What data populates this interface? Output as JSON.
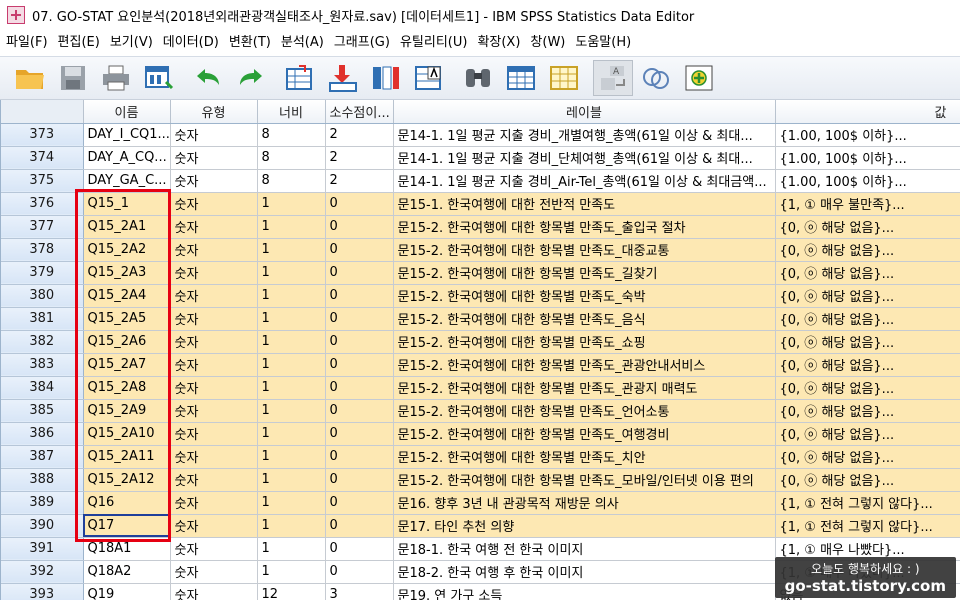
{
  "window": {
    "title": "07. GO-STAT 요인분석(2018년외래관광객실태조사_원자료.sav) [데이터세트1] - IBM SPSS Statistics Data Editor"
  },
  "menu": [
    {
      "label": "파일(F)"
    },
    {
      "label": "편집(E)"
    },
    {
      "label": "보기(V)"
    },
    {
      "label": "데이터(D)"
    },
    {
      "label": "변환(T)"
    },
    {
      "label": "분석(A)"
    },
    {
      "label": "그래프(G)"
    },
    {
      "label": "유틸리티(U)"
    },
    {
      "label": "확장(X)"
    },
    {
      "label": "창(W)"
    },
    {
      "label": "도움말(H)"
    }
  ],
  "toolbar": {
    "icons": [
      "open-folder-icon",
      "save-icon",
      "print-icon",
      "dialog-recall-icon",
      "undo-icon",
      "redo-icon",
      "goto-case-icon",
      "goto-variable-icon",
      "variables-icon",
      "run-descriptives-icon",
      "find-icon",
      "insert-cases-icon",
      "insert-variable-icon",
      "split-file-icon",
      "value-labels-icon",
      "use-sets-icon"
    ]
  },
  "columns": [
    {
      "label": ""
    },
    {
      "label": "이름"
    },
    {
      "label": "유형"
    },
    {
      "label": "너비"
    },
    {
      "label": "소수점이..."
    },
    {
      "label": "레이블"
    },
    {
      "label": "값"
    }
  ],
  "rows": [
    {
      "num": "373",
      "name": "DAY_I_CQ1...",
      "type": "숫자",
      "width": "8",
      "decimals": "2",
      "label": "문14-1. 1일 평균 지출 경비_개별여행_총액(61일 이상 & 최대...",
      "values": "{1.00, 100$ 이하}...",
      "hl": false
    },
    {
      "num": "374",
      "name": "DAY_A_CQ...",
      "type": "숫자",
      "width": "8",
      "decimals": "2",
      "label": "문14-1. 1일 평균 지출 경비_단체여행_총액(61일 이상 & 최대...",
      "values": "{1.00, 100$ 이하}...",
      "hl": false
    },
    {
      "num": "375",
      "name": "DAY_GA_C...",
      "type": "숫자",
      "width": "8",
      "decimals": "2",
      "label": "문14-1. 1일 평균 지출 경비_Air-Tel_총액(61일 이상 & 최대금액...",
      "values": "{1.00, 100$ 이하}...",
      "hl": false
    },
    {
      "num": "376",
      "name": "Q15_1",
      "type": "숫자",
      "width": "1",
      "decimals": "0",
      "label": "문15-1. 한국여행에 대한 전반적 만족도",
      "values": "{1, ① 매우 불만족}...",
      "hl": true
    },
    {
      "num": "377",
      "name": "Q15_2A1",
      "type": "숫자",
      "width": "1",
      "decimals": "0",
      "label": "문15-2. 한국여행에 대한 항목별 만족도_출입국 절차",
      "values": "{0, ⓞ 해당 없음}...",
      "hl": true
    },
    {
      "num": "378",
      "name": "Q15_2A2",
      "type": "숫자",
      "width": "1",
      "decimals": "0",
      "label": "문15-2. 한국여행에 대한 항목별 만족도_대중교통",
      "values": "{0, ⓞ 해당 없음}...",
      "hl": true
    },
    {
      "num": "379",
      "name": "Q15_2A3",
      "type": "숫자",
      "width": "1",
      "decimals": "0",
      "label": "문15-2. 한국여행에 대한 항목별 만족도_길찾기",
      "values": "{0, ⓞ 해당 없음}...",
      "hl": true
    },
    {
      "num": "380",
      "name": "Q15_2A4",
      "type": "숫자",
      "width": "1",
      "decimals": "0",
      "label": "문15-2. 한국여행에 대한 항목별 만족도_숙박",
      "values": "{0, ⓞ 해당 없음}...",
      "hl": true
    },
    {
      "num": "381",
      "name": "Q15_2A5",
      "type": "숫자",
      "width": "1",
      "decimals": "0",
      "label": "문15-2. 한국여행에 대한 항목별 만족도_음식",
      "values": "{0, ⓞ 해당 없음}...",
      "hl": true
    },
    {
      "num": "382",
      "name": "Q15_2A6",
      "type": "숫자",
      "width": "1",
      "decimals": "0",
      "label": "문15-2. 한국여행에 대한 항목별 만족도_쇼핑",
      "values": "{0, ⓞ 해당 없음}...",
      "hl": true
    },
    {
      "num": "383",
      "name": "Q15_2A7",
      "type": "숫자",
      "width": "1",
      "decimals": "0",
      "label": "문15-2. 한국여행에 대한 항목별 만족도_관광안내서비스",
      "values": "{0, ⓞ 해당 없음}...",
      "hl": true
    },
    {
      "num": "384",
      "name": "Q15_2A8",
      "type": "숫자",
      "width": "1",
      "decimals": "0",
      "label": "문15-2. 한국여행에 대한 항목별 만족도_관광지 매력도",
      "values": "{0, ⓞ 해당 없음}...",
      "hl": true
    },
    {
      "num": "385",
      "name": "Q15_2A9",
      "type": "숫자",
      "width": "1",
      "decimals": "0",
      "label": "문15-2. 한국여행에 대한 항목별 만족도_언어소통",
      "values": "{0, ⓞ 해당 없음}...",
      "hl": true
    },
    {
      "num": "386",
      "name": "Q15_2A10",
      "type": "숫자",
      "width": "1",
      "decimals": "0",
      "label": "문15-2. 한국여행에 대한 항목별 만족도_여행경비",
      "values": "{0, ⓞ 해당 없음}...",
      "hl": true
    },
    {
      "num": "387",
      "name": "Q15_2A11",
      "type": "숫자",
      "width": "1",
      "decimals": "0",
      "label": "문15-2. 한국여행에 대한 항목별 만족도_치안",
      "values": "{0, ⓞ 해당 없음}...",
      "hl": true
    },
    {
      "num": "388",
      "name": "Q15_2A12",
      "type": "숫자",
      "width": "1",
      "decimals": "0",
      "label": "문15-2. 한국여행에 대한 항목별 만족도_모바일/인터넷 이용 편의",
      "values": "{0, ⓞ 해당 없음}...",
      "hl": true
    },
    {
      "num": "389",
      "name": "Q16",
      "type": "숫자",
      "width": "1",
      "decimals": "0",
      "label": "문16. 향후 3년 내 관광목적 재방문 의사",
      "values": "{1, ① 전혀 그렇지 않다}...",
      "hl": true
    },
    {
      "num": "390",
      "name": "Q17",
      "type": "숫자",
      "width": "1",
      "decimals": "0",
      "label": "문17. 타인 추천 의향",
      "values": "{1, ① 전혀 그렇지 않다}...",
      "hl": true,
      "active": true
    },
    {
      "num": "391",
      "name": "Q18A1",
      "type": "숫자",
      "width": "1",
      "decimals": "0",
      "label": "문18-1. 한국 여행 전 한국 이미지",
      "values": "{1, ① 매우 나빴다}...",
      "hl": false
    },
    {
      "num": "392",
      "name": "Q18A2",
      "type": "숫자",
      "width": "1",
      "decimals": "0",
      "label": "문18-2. 한국 여행 후 한국 이미지",
      "values": "{1, ① 매우 나빴다}...",
      "hl": false
    },
    {
      "num": "393",
      "name": "Q19",
      "type": "숫자",
      "width": "12",
      "decimals": "3",
      "label": "문19. 연 가구 소득",
      "values": "없음",
      "hl": false
    }
  ],
  "watermark": {
    "line1": "오늘도 행복하세요 : )",
    "line2": "go-stat.tistory.com"
  }
}
